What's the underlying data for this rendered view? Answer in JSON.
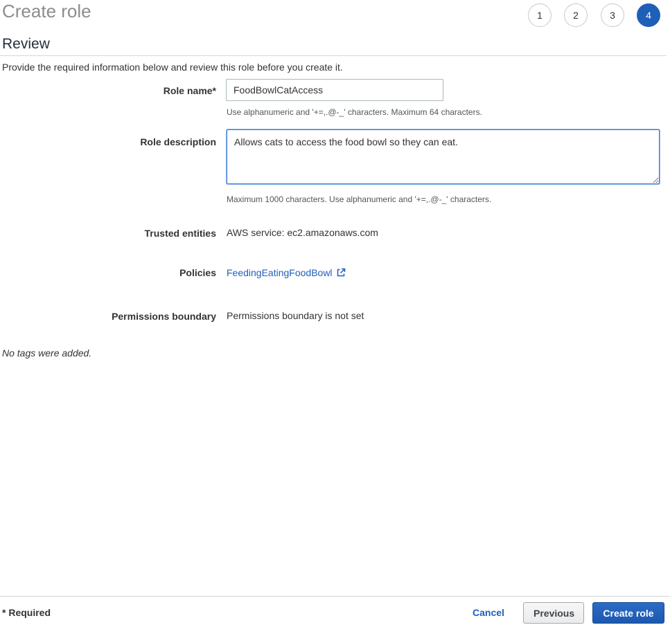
{
  "page": {
    "title": "Create role",
    "steps": [
      "1",
      "2",
      "3",
      "4"
    ],
    "active_step": "4"
  },
  "review": {
    "heading": "Review",
    "intro": "Provide the required information below and review this role before you create it."
  },
  "form": {
    "role_name": {
      "label": "Role name*",
      "value": "FoodBowlCatAccess",
      "hint": "Use alphanumeric and '+=,.@-_' characters. Maximum 64 characters."
    },
    "role_description": {
      "label": "Role description",
      "value": "Allows cats to access the food bowl so they can eat.",
      "hint": "Maximum 1000 characters. Use alphanumeric and '+=,.@-_' characters."
    },
    "trusted_entities": {
      "label": "Trusted entities",
      "value": "AWS service: ec2.amazonaws.com"
    },
    "policies": {
      "label": "Policies",
      "link": "FeedingEatingFoodBowl",
      "icon": "external-link-icon"
    },
    "permissions_boundary": {
      "label": "Permissions boundary",
      "value": "Permissions boundary is not set"
    }
  },
  "tags": {
    "message": "No tags were added."
  },
  "footer": {
    "required_note": "* Required",
    "cancel_label": "Cancel",
    "previous_label": "Previous",
    "create_label": "Create role"
  },
  "colors": {
    "accent": "#1f5fb8",
    "title_gray": "#8d8d8d",
    "border": "#d5d5d5"
  }
}
